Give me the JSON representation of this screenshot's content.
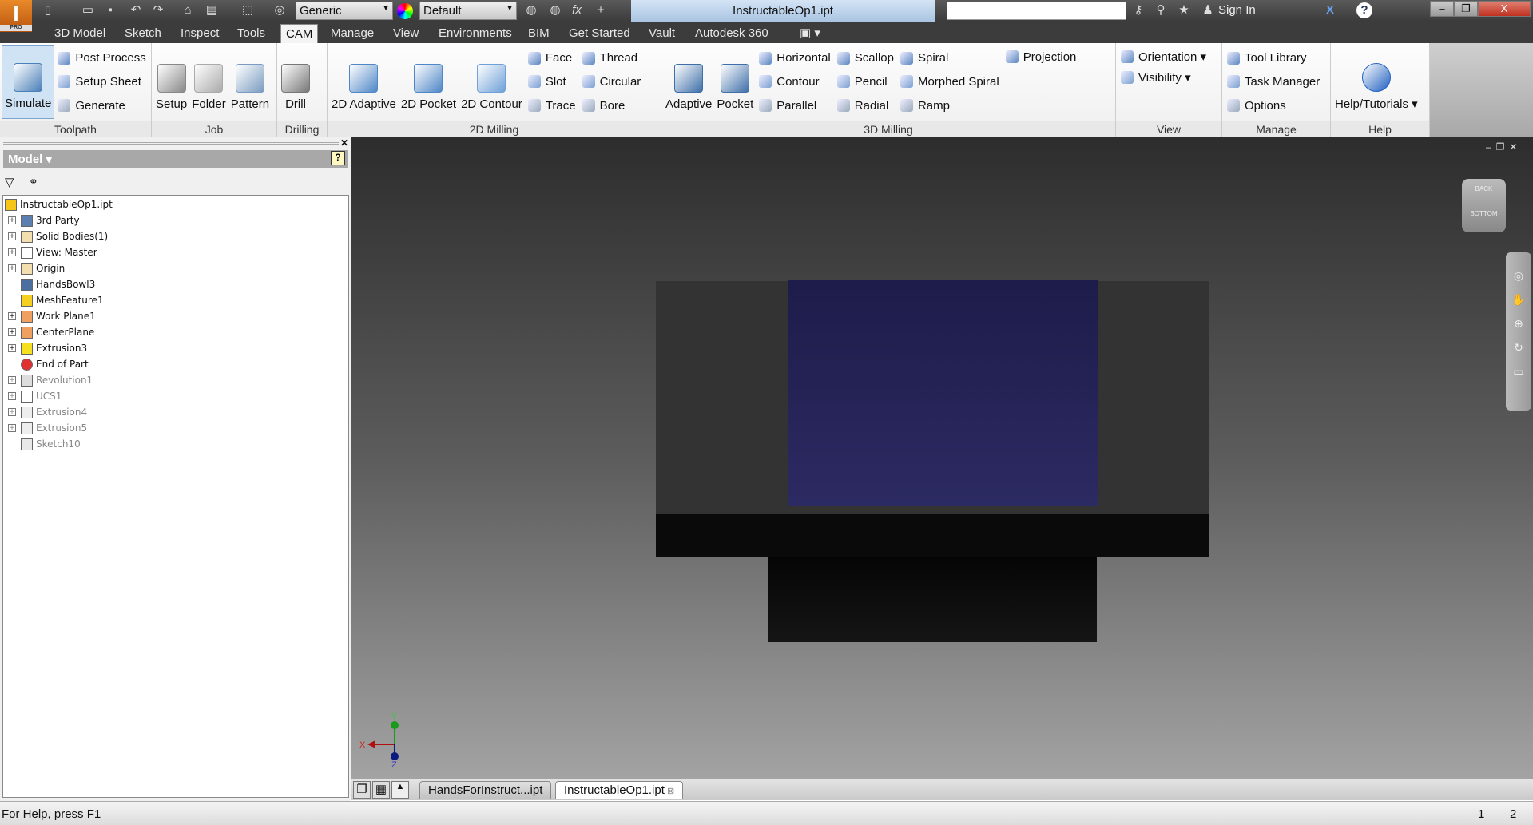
{
  "app": {
    "badge": "I",
    "edition": "PRO",
    "document_title": "InstructableOp1.ipt",
    "material": "Generic",
    "appearance": "Default",
    "sign_in": "Sign In"
  },
  "quick_access_icons": [
    "new-icon",
    "open-icon",
    "save-icon",
    "undo-icon",
    "redo-icon",
    "home-icon",
    "update-icon",
    "select-icon",
    "color-icon"
  ],
  "tabs": [
    "3D Model",
    "Sketch",
    "Inspect",
    "Tools",
    "CAM",
    "Manage",
    "View",
    "Environments",
    "BIM",
    "Get Started",
    "Vault",
    "Autodesk 360"
  ],
  "active_tab": "CAM",
  "ribbon": [
    {
      "label": "Toolpath",
      "groups": [
        {
          "type": "large",
          "label": "Simulate",
          "selected": true,
          "color": "#4a7fb8"
        },
        {
          "type": "col",
          "items": [
            "Post Process",
            "Setup Sheet",
            "Generate"
          ]
        }
      ]
    },
    {
      "label": "Job",
      "groups": [
        {
          "type": "large",
          "label": "Setup",
          "color": "#888"
        },
        {
          "type": "large",
          "label": "Folder",
          "color": "#aaa"
        },
        {
          "type": "large",
          "label": "Pattern",
          "color": "#7a9cc0"
        }
      ]
    },
    {
      "label": "Drilling",
      "groups": [
        {
          "type": "large",
          "label": "Drill",
          "color": "#777"
        }
      ]
    },
    {
      "label": "2D Milling",
      "groups": [
        {
          "type": "large",
          "label": "2D Adaptive",
          "color": "#4f87c6"
        },
        {
          "type": "large",
          "label": "2D Pocket",
          "color": "#4f87c6"
        },
        {
          "type": "large",
          "label": "2D Contour",
          "color": "#6fa0d8"
        },
        {
          "type": "col",
          "items": [
            "Face",
            "Slot",
            "Trace"
          ]
        },
        {
          "type": "col",
          "items": [
            "Thread",
            "Circular",
            "Bore"
          ]
        }
      ]
    },
    {
      "label": "3D Milling",
      "groups": [
        {
          "type": "large",
          "label": "Adaptive",
          "color": "#3f6fa8"
        },
        {
          "type": "large",
          "label": "Pocket",
          "color": "#3f6fa8"
        },
        {
          "type": "col",
          "items": [
            "Horizontal",
            "Contour",
            "Parallel"
          ]
        },
        {
          "type": "col",
          "items": [
            "Scallop",
            "Pencil",
            "Radial"
          ]
        },
        {
          "type": "col",
          "items": [
            "Spiral",
            "Morphed Spiral",
            "Ramp"
          ]
        },
        {
          "type": "col",
          "items": [
            "Projection"
          ]
        }
      ]
    },
    {
      "label": "View",
      "groups": [
        {
          "type": "col",
          "items": [
            "Orientation ▾",
            "Visibility ▾"
          ]
        }
      ]
    },
    {
      "label": "Manage",
      "groups": [
        {
          "type": "col",
          "items": [
            "Tool Library",
            "Task Manager",
            "Options"
          ]
        }
      ]
    },
    {
      "label": "Help",
      "groups": [
        {
          "type": "large",
          "label": "Help/Tutorials ▾",
          "color": "#1f5fc0"
        }
      ]
    }
  ],
  "browser": {
    "title": "Model ▾",
    "items": [
      {
        "label": "InstructableOp1.ipt",
        "expand": false,
        "root": true,
        "dim": false,
        "color": "#f5c518"
      },
      {
        "label": "3rd Party",
        "expand": true,
        "dim": false,
        "color": "#5a7fb0"
      },
      {
        "label": "Solid Bodies(1)",
        "expand": true,
        "dim": false,
        "color": "#f3deb0"
      },
      {
        "label": "View: Master",
        "expand": true,
        "dim": false,
        "color": "#ffffff"
      },
      {
        "label": "Origin",
        "expand": true,
        "dim": false,
        "color": "#f3deb0"
      },
      {
        "label": "HandsBowl3",
        "expand": false,
        "dim": false,
        "color": "#4a6fa0"
      },
      {
        "label": "MeshFeature1",
        "expand": false,
        "dim": false,
        "color": "#f5d020"
      },
      {
        "label": "Work Plane1",
        "expand": true,
        "dim": false,
        "color": "#f0a060"
      },
      {
        "label": "CenterPlane",
        "expand": true,
        "dim": false,
        "color": "#f0a060"
      },
      {
        "label": "Extrusion3",
        "expand": true,
        "dim": false,
        "color": "#f5e020"
      },
      {
        "label": "End of Part",
        "expand": false,
        "dim": false,
        "color": "#e03030"
      },
      {
        "label": "Revolution1",
        "expand": true,
        "dim": true,
        "color": "#dddddd"
      },
      {
        "label": "UCS1",
        "expand": true,
        "dim": true,
        "color": "#ffffff"
      },
      {
        "label": "Extrusion4",
        "expand": true,
        "dim": true,
        "color": "#eeeeee"
      },
      {
        "label": "Extrusion5",
        "expand": true,
        "dim": true,
        "color": "#eeeeee"
      },
      {
        "label": "Sketch10",
        "expand": false,
        "dim": true,
        "color": "#e8e8e8"
      }
    ]
  },
  "viewcube": {
    "top": "BACK",
    "bottom": "BOTTOM"
  },
  "axes": {
    "x": "X",
    "y": "Y",
    "z": "Z"
  },
  "doc_tabs": [
    {
      "label": "HandsForInstruct...ipt",
      "active": false
    },
    {
      "label": "InstructableOp1.ipt",
      "active": true
    }
  ],
  "status": {
    "help": "For Help, press F1",
    "num1": "1",
    "num2": "2"
  },
  "colors": {
    "face": "#23214f",
    "edge": "#e6e040",
    "ribbon_selected": "#cfe3f5"
  }
}
